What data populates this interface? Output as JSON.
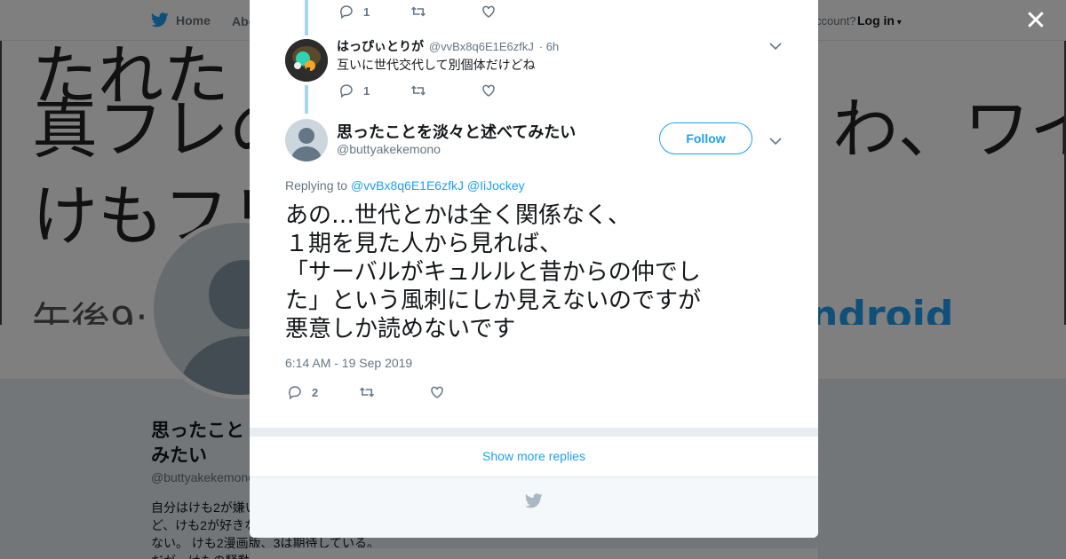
{
  "background": {
    "nav": {
      "home_label": "Home",
      "about_label": "Abo",
      "account_text": "ccount?",
      "login_label": "Log in"
    },
    "banner": {
      "line1": "たれた",
      "line2": "真フレの",
      "line2_right": "わ、ワイ",
      "line3": "けもフレ",
      "time_text": "午後9:",
      "right_text": "ndroid"
    },
    "profile": {
      "name": "思ったこと\nみたい",
      "handle": "@buttyakekemono",
      "bio": "自分はけも2が嫌い\nど、けも2が好きな\nない。 けも2漫画版、3は期待している。\nだが、けもの騒動"
    }
  },
  "modal": {
    "prev_tweet_actions": {
      "reply_count": "1"
    },
    "reply": {
      "name": "はっぴぃとりが",
      "handle": "@vvBx8q6E1E6zfkJ",
      "time": "· 6h",
      "text": "互いに世代交代して別個体だけどね",
      "reply_count": "1"
    },
    "main": {
      "name": "思ったことを淡々と述べてみたい",
      "handle": "@buttyakekemono",
      "follow_label": "Follow",
      "replying_prefix": "Replying to",
      "replying_to": [
        "@vvBx8q6E1E6zfkJ",
        "@IiJockey"
      ],
      "text_lines": [
        "あの…世代とかは全く関係なく、",
        "１期を見た人から見れば、",
        "「サーバルがキュルルと昔からの仲でし",
        "た」という風刺にしか見えないのですが",
        "悪意しか読めないです"
      ],
      "timestamp": "6:14 AM - 19 Sep 2019",
      "reply_count": "2"
    },
    "show_more_label": "Show more replies"
  },
  "colors": {
    "accent": "#1da1f2",
    "thread_line": "#a3d5f5",
    "muted": "#657786"
  },
  "icons": [
    "twitter-bird-icon",
    "reply-icon",
    "retweet-icon",
    "like-icon",
    "chevron-down-icon",
    "close-icon"
  ]
}
